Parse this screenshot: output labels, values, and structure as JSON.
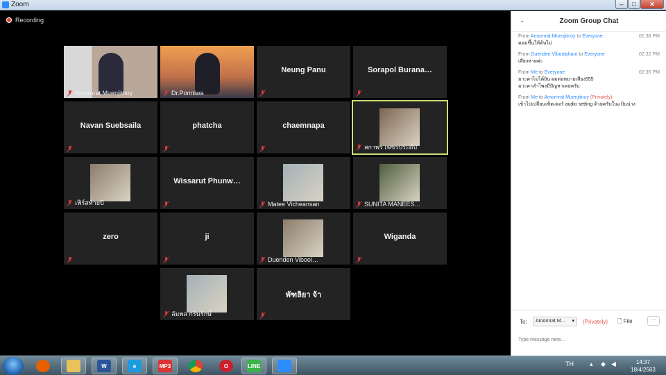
{
  "window": {
    "title": "Zoom"
  },
  "recording": {
    "label": "Recording"
  },
  "participants": [
    {
      "name": "Amornrat Muenjitnoy",
      "display": "video"
    },
    {
      "name": "Dr.Porntiwa",
      "display": "video"
    },
    {
      "name": "Neung Panu",
      "display": "name"
    },
    {
      "name": "Sorapol  Burana…",
      "display": "name"
    },
    {
      "name": "Navan Suebsaila",
      "display": "name"
    },
    {
      "name": "phatcha",
      "display": "name"
    },
    {
      "name": "chaemnapa",
      "display": "name"
    },
    {
      "name": "สกาพร เพชรประดับ",
      "display": "photo",
      "active": true
    },
    {
      "name": "เฟิร์สท้ายปี",
      "display": "photo"
    },
    {
      "name": "Wissarut  Phunw…",
      "display": "name"
    },
    {
      "name": "Matee Vicheansan",
      "display": "photo"
    },
    {
      "name": "SUNITA MANEES…",
      "display": "photo"
    },
    {
      "name": "zero",
      "display": "name"
    },
    {
      "name": "ji",
      "display": "name"
    },
    {
      "name": "Duenden Vibool…",
      "display": "photo"
    },
    {
      "name": "Wiganda",
      "display": "name"
    },
    {
      "name": "ลัมพล กรินรักษ์",
      "display": "photo"
    },
    {
      "name": "พัฑลิยา จ้า",
      "display": "name"
    }
  ],
  "chat": {
    "title": "Zoom Group Chat",
    "messages": [
      {
        "from_word": "From",
        "sender": "Amornrat Muenjitnoy",
        "to_word": "to",
        "recipient": "Everyone",
        "private": "",
        "time": "01:38 PM",
        "lines": [
          "คอมขึ้นให้ต้นไม่"
        ]
      },
      {
        "from_word": "From",
        "sender": "Duenden Viboolphant",
        "to_word": "to",
        "recipient": "Everyone",
        "private": "",
        "time": "02:32 PM",
        "lines": [
          "เสียงหายค่ะ"
        ]
      },
      {
        "from_word": "From",
        "sender": "Me",
        "to_word": "to",
        "recipient": "Everyone",
        "private": "",
        "time": "02:35 PM",
        "lines": [
          "มาะคาไม่ได้ยิน ผมต่อหมายเสียง555",
          "มาะคาลำโพงมีปัญหาเคยครับ"
        ]
      },
      {
        "from_word": "From",
        "sender": "Me",
        "to_word": "to",
        "recipient": "Amornrat Muenjitnoy",
        "private": "(Privately)",
        "time": "",
        "lines": [
          "เข้าไปเปลี่ยนเซ็ตเตอร์ audio setting ด้วยครับในแป้นน่าง"
        ]
      }
    ],
    "to_label": "To:",
    "to_value": "Amornrat M...",
    "private_label": "(Privately)",
    "file_label": "File",
    "more_label": "···",
    "input_placeholder": "Type message here..."
  },
  "taskbar": {
    "apps": [
      {
        "icon": "firefox-icon",
        "label": ""
      },
      {
        "icon": "folder-icon",
        "label": ""
      },
      {
        "icon": "word-icon",
        "label": "W"
      },
      {
        "icon": "ie-icon",
        "label": "e"
      },
      {
        "icon": "mp3-icon",
        "label": "MP3"
      },
      {
        "icon": "chrome-icon",
        "label": ""
      },
      {
        "icon": "opera-icon",
        "label": "O"
      },
      {
        "icon": "line-icon",
        "label": "LINE"
      },
      {
        "icon": "zoom-icon",
        "label": ""
      }
    ],
    "lang": "TH",
    "time": "14:37",
    "date": "18/4/2563"
  },
  "colors": {
    "active_speaker": "#c8e07a",
    "muted": "#d23a3a",
    "accent": "#2d8cff",
    "private": "#e05c4b"
  }
}
